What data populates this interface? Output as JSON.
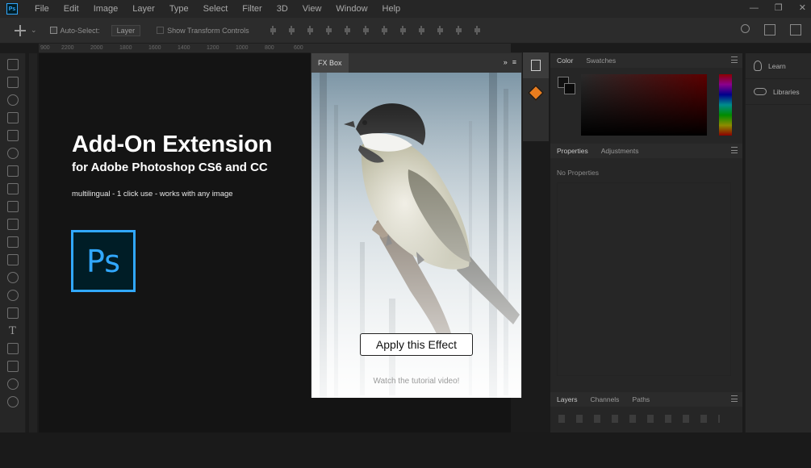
{
  "menubar": {
    "logo": "Ps",
    "items": [
      "File",
      "Edit",
      "Image",
      "Layer",
      "Type",
      "Select",
      "Filter",
      "3D",
      "View",
      "Window",
      "Help"
    ],
    "window_controls": [
      "—",
      "❐",
      "✕"
    ]
  },
  "options": {
    "auto_select_label": "Auto-Select:",
    "auto_select_target": "Layer",
    "show_transform_label": "Show Transform Controls"
  },
  "ruler": [
    "900",
    "2200",
    "2000",
    "1800",
    "1600",
    "1400",
    "1200",
    "1000",
    "800",
    "600"
  ],
  "promo": {
    "title": "Add-On Extension",
    "subtitle": "for Adobe Photoshop CS6 and CC",
    "features": "multilingual - 1 click use - works with any image",
    "logo": "Ps"
  },
  "fx_panel": {
    "tab": "FX Box",
    "expand": "»",
    "menu": "≡",
    "apply_label": "Apply this Effect",
    "tutorial_label": "Watch the tutorial video!"
  },
  "panels": {
    "color_tabs": [
      "Color",
      "Swatches"
    ],
    "props_tabs": [
      "Properties",
      "Adjustments"
    ],
    "no_properties": "No Properties",
    "layers_tabs": [
      "Layers",
      "Channels",
      "Paths"
    ]
  },
  "learn": {
    "learn_label": "Learn",
    "libraries_label": "Libraries"
  },
  "colors": {
    "ps_blue": "#31a8ff",
    "ps_dark": "#001d26",
    "accent_orange": "#e87c1e"
  }
}
